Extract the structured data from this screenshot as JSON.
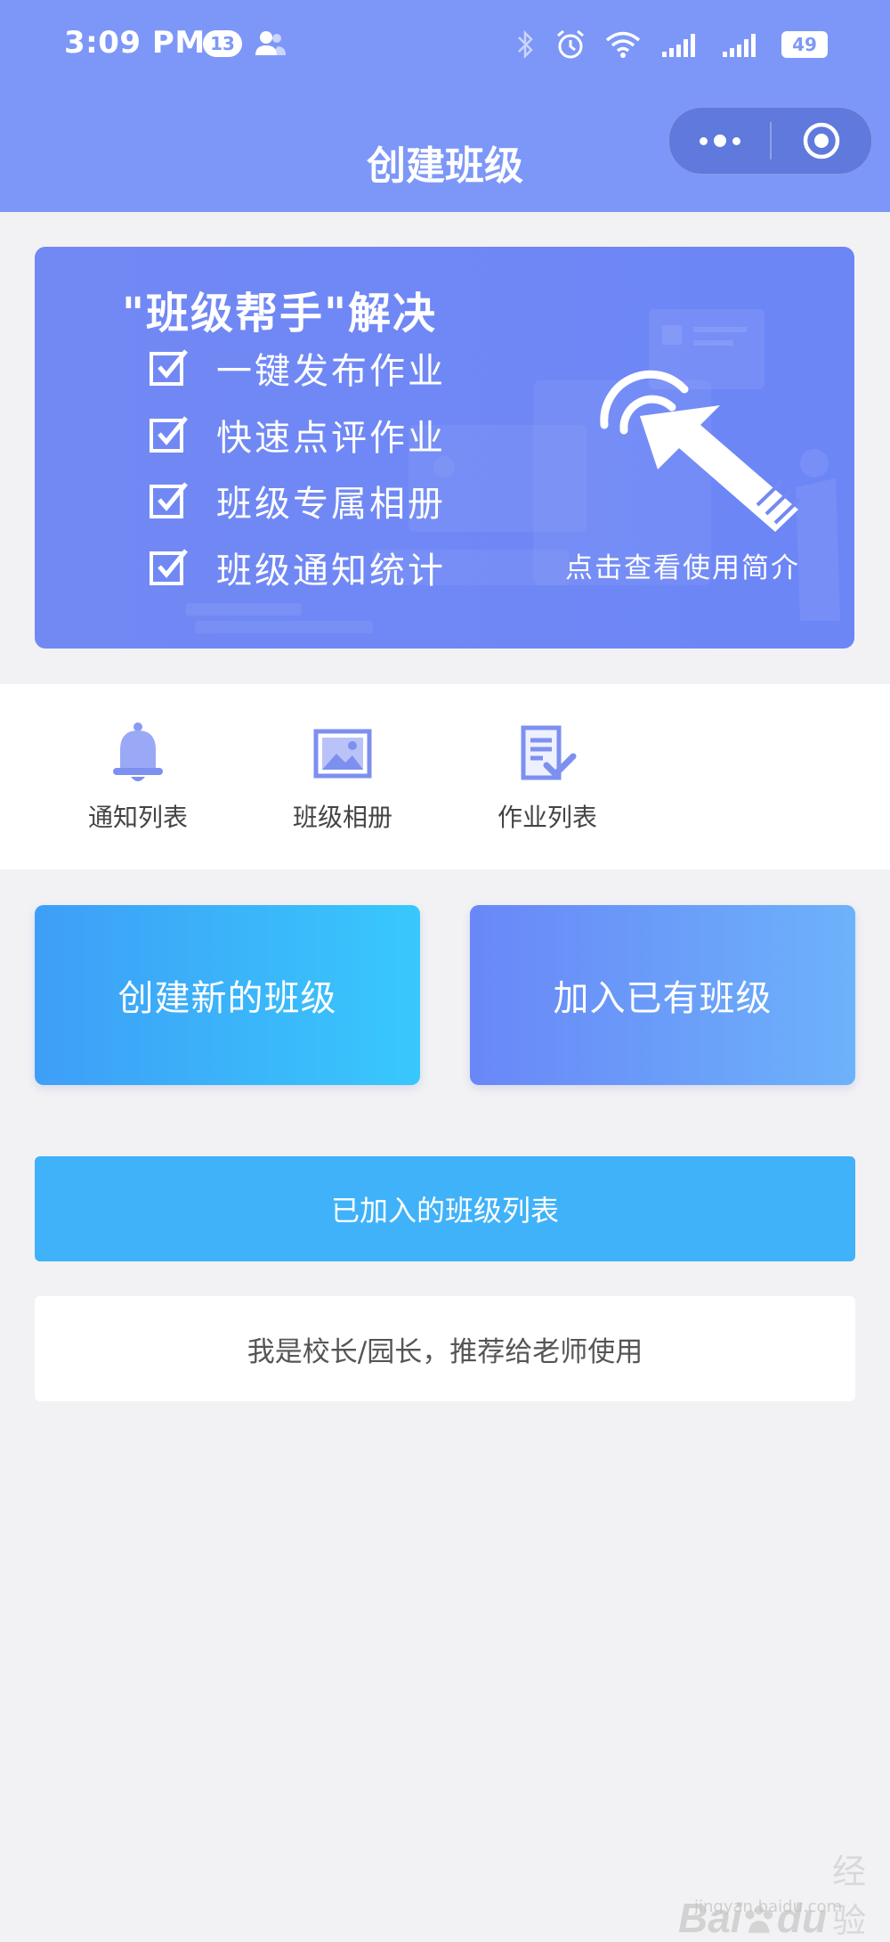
{
  "status_bar": {
    "time": "3:09 PM",
    "notification_count": "13",
    "battery": "49",
    "icons": [
      "person-icon",
      "bluetooth-icon",
      "alarm-icon",
      "wifi-icon",
      "signal-icon",
      "signal-2-icon",
      "battery-icon"
    ]
  },
  "header": {
    "title": "创建班级",
    "capsule_icons": [
      "more-icon",
      "close-target-icon"
    ]
  },
  "banner": {
    "heading": "\"班级帮手\"解决",
    "features": [
      "一键发布作业",
      "快速点评作业",
      "班级专属相册",
      "班级通知统计"
    ],
    "cta": "点击查看使用简介"
  },
  "shortcuts": [
    {
      "label": "通知列表",
      "icon": "bell-icon"
    },
    {
      "label": "班级相册",
      "icon": "photo-icon"
    },
    {
      "label": "作业列表",
      "icon": "homework-list-icon"
    }
  ],
  "actions": {
    "create": "创建新的班级",
    "join": "加入已有班级",
    "joined_list": "已加入的班级列表",
    "recommend": "我是校长/园长，推荐给老师使用"
  },
  "watermark": {
    "brand": "Bai",
    "brand_tail": "du",
    "sub": "经验",
    "url": "jingyan.baidu.com"
  },
  "colors": {
    "header": "#7d97f8",
    "banner": "#7289f4",
    "create_gradient": [
      "#3e9ef7",
      "#38c8fc"
    ],
    "join_gradient": [
      "#6987f8",
      "#6cb2fa"
    ],
    "list_button": "#40b2f9",
    "icon": "#7d90f0"
  }
}
